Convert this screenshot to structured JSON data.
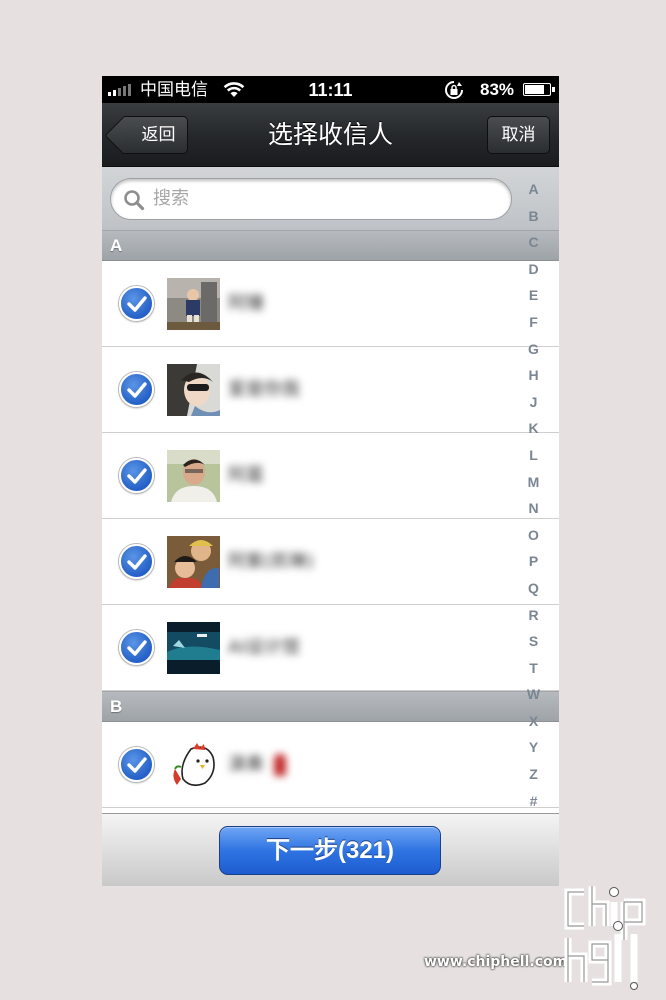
{
  "status_bar": {
    "carrier": "中国电信",
    "time": "11:11",
    "battery_text": "83%",
    "battery_level": 0.83,
    "signal_bars_filled": 2,
    "signal_bars_total": 5
  },
  "nav": {
    "back_label": "返回",
    "title": "选择收信人",
    "cancel_label": "取消"
  },
  "search": {
    "placeholder": "搜索"
  },
  "sections": [
    {
      "letter": "A",
      "contacts": [
        {
          "name": "阿锤",
          "checked": true
        },
        {
          "name": "爱是你我",
          "checked": true
        },
        {
          "name": "阿葛",
          "checked": true
        },
        {
          "name": "阿紫(凯琳)",
          "checked": true
        },
        {
          "name": "AI设计馆",
          "checked": true
        }
      ]
    },
    {
      "letter": "B",
      "contacts": [
        {
          "name": "演奏",
          "checked": true
        }
      ]
    }
  ],
  "index": [
    "A",
    "B",
    "C",
    "D",
    "E",
    "F",
    "G",
    "H",
    "J",
    "K",
    "L",
    "M",
    "N",
    "O",
    "P",
    "Q",
    "R",
    "S",
    "T",
    "W",
    "X",
    "Y",
    "Z",
    "#"
  ],
  "bottom": {
    "next_label": "下一步(321)"
  },
  "watermark": {
    "url": "www.chiphell.com",
    "logo_text": "chip hell"
  },
  "colors": {
    "accent_blue": "#2f74e2",
    "nav_dark": "#24272a",
    "index_text": "#7b8693"
  }
}
